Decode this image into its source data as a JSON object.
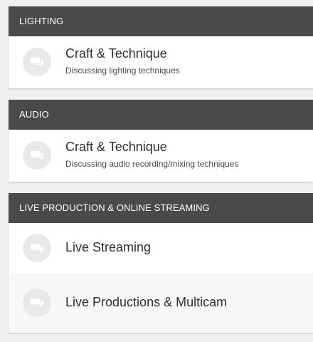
{
  "sections": [
    {
      "header": "LIGHTING",
      "forums": [
        {
          "title": "Craft & Technique",
          "description": "Discussing lighting techniques",
          "icon": "chat-bubbles-icon"
        }
      ]
    },
    {
      "header": "AUDIO",
      "forums": [
        {
          "title": "Craft & Technique",
          "description": "Discussing audio recording/mixing techniques",
          "icon": "chat-bubbles-icon"
        }
      ]
    },
    {
      "header": "LIVE PRODUCTION & ONLINE STREAMING",
      "forums": [
        {
          "title": "Live Streaming",
          "icon": "chat-bubbles-icon"
        },
        {
          "title": "Live Productions & Multicam",
          "icon": "chat-bubbles-icon"
        }
      ]
    }
  ],
  "colors": {
    "background": "#efefef",
    "header_bg": "#4a4a4a",
    "header_text": "#ffffff",
    "icon_circle": "#e9e9e9",
    "icon_glyph": "#ffffff",
    "title_text": "#2f2f2f",
    "desc_text": "#4a4a4a"
  }
}
